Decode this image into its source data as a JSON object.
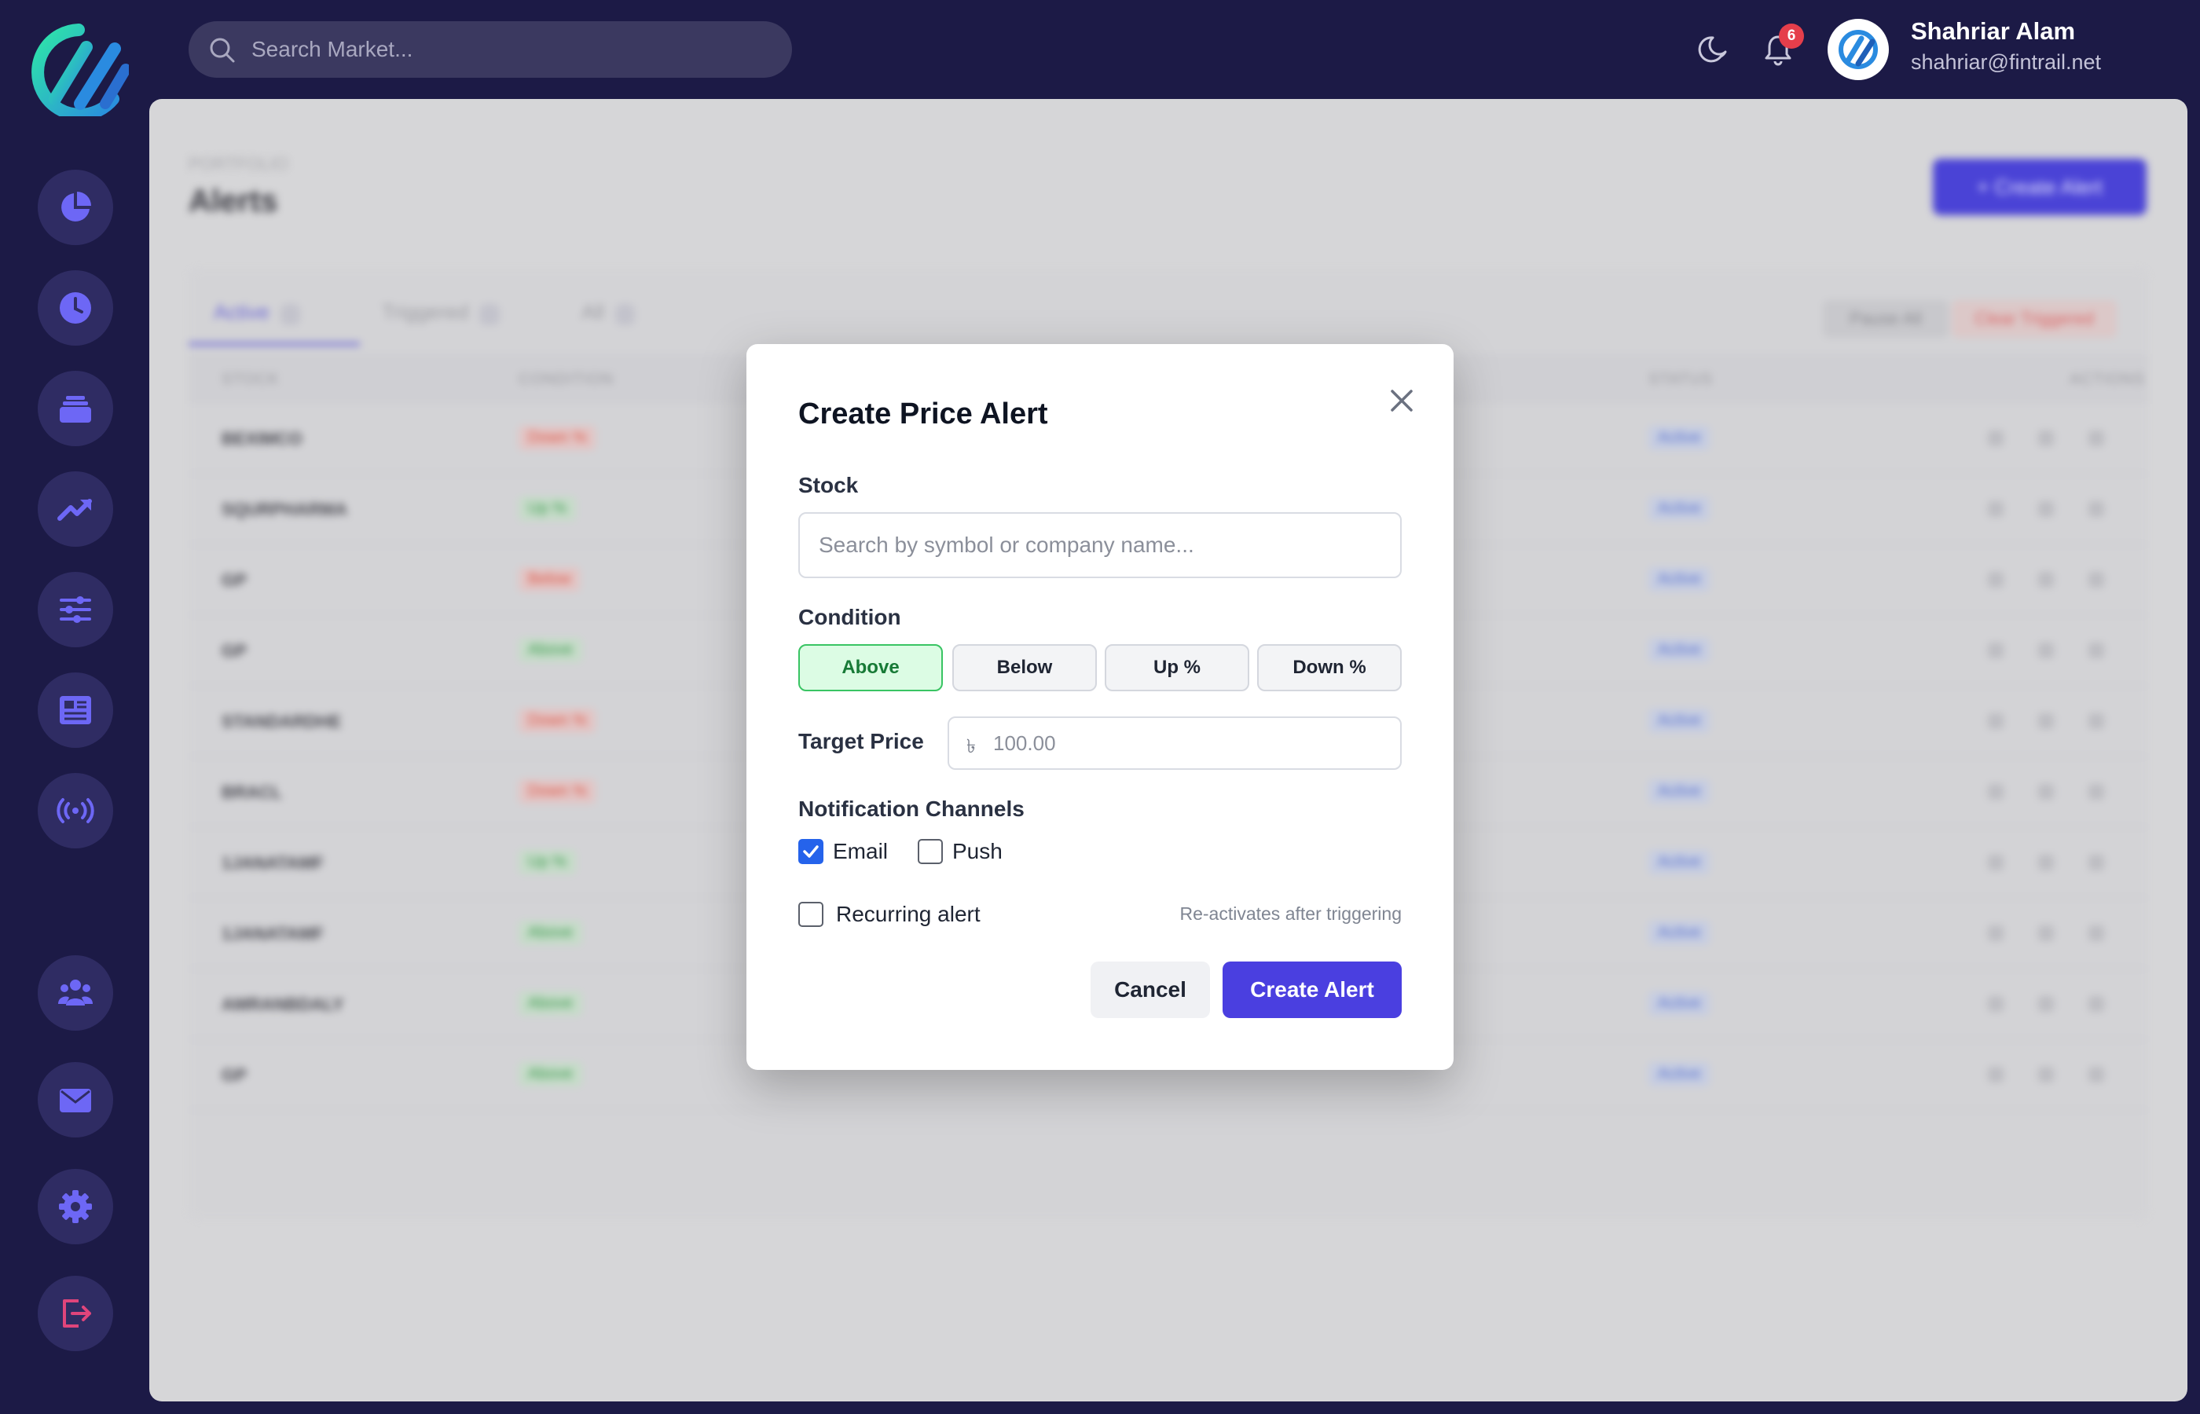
{
  "topbar": {
    "search_placeholder": "Search Market...",
    "notification_count": "6",
    "user_name": "Shahriar Alam",
    "user_email": "shahriar@fintrail.net"
  },
  "sidebar": {
    "items": [
      {
        "icon": "pie-chart-icon"
      },
      {
        "icon": "clock-icon"
      },
      {
        "icon": "stack-icon"
      },
      {
        "icon": "trending-up-icon"
      },
      {
        "icon": "sliders-icon"
      },
      {
        "icon": "newspaper-icon"
      },
      {
        "icon": "broadcast-icon"
      },
      {
        "icon": "users-icon"
      },
      {
        "icon": "mail-icon"
      },
      {
        "icon": "gear-icon"
      },
      {
        "icon": "logout-icon"
      }
    ]
  },
  "page": {
    "breadcrumb": "PORTFOLIO",
    "title": "Alerts",
    "create_button": "+ Create Alert",
    "tabs": [
      "Active",
      "Triggered",
      "All"
    ],
    "pause_all": "Pause All",
    "clear_triggered": "Clear Triggered",
    "columns": [
      "STOCK",
      "CONDITION",
      "STATUS",
      "ACTIONS"
    ],
    "rows": [
      {
        "symbol": "BEXIMCO",
        "condition": "Down %",
        "tone": "red",
        "status": "Active"
      },
      {
        "symbol": "SQURPHARMA",
        "condition": "Up %",
        "tone": "green",
        "status": "Active"
      },
      {
        "symbol": "GP",
        "condition": "Below",
        "tone": "red",
        "status": "Active"
      },
      {
        "symbol": "GP",
        "condition": "Above",
        "tone": "green",
        "status": "Active"
      },
      {
        "symbol": "STANDARDHE",
        "condition": "Down %",
        "tone": "red",
        "status": "Active"
      },
      {
        "symbol": "BRACL",
        "condition": "Down %",
        "tone": "red",
        "status": "Active"
      },
      {
        "symbol": "1JANATAMF",
        "condition": "Up %",
        "tone": "green",
        "status": "Active"
      },
      {
        "symbol": "1JANATAMF",
        "condition": "Above",
        "tone": "green",
        "status": "Active"
      },
      {
        "symbol": "AMRANBDALY",
        "condition": "Above",
        "tone": "green",
        "status": "Active"
      },
      {
        "symbol": "GP",
        "condition": "Above",
        "tone": "green",
        "status": "Active"
      }
    ]
  },
  "modal": {
    "title": "Create Price Alert",
    "stock_label": "Stock",
    "stock_placeholder": "Search by symbol or company name...",
    "condition_label": "Condition",
    "conditions": [
      "Above",
      "Below",
      "Up %",
      "Down %"
    ],
    "selected_condition": "Above",
    "target_label": "Target Price",
    "currency_symbol": "৳",
    "target_placeholder": "100.00",
    "channels_label": "Notification Channels",
    "email_label": "Email",
    "email_checked": true,
    "push_label": "Push",
    "push_checked": false,
    "recurring_label": "Recurring alert",
    "recurring_checked": false,
    "recurring_hint": "Re-activates after triggering",
    "cancel": "Cancel",
    "submit": "Create Alert"
  },
  "colors": {
    "sidebar_bg": "#1c1a46",
    "accent": "#4a3fe0",
    "selected_condition_bg": "#dcfce4",
    "selected_condition_border": "#39c463",
    "badge": "#e53e4b",
    "icon_purple": "#6d67f5",
    "logout_pink": "#e0457b"
  }
}
